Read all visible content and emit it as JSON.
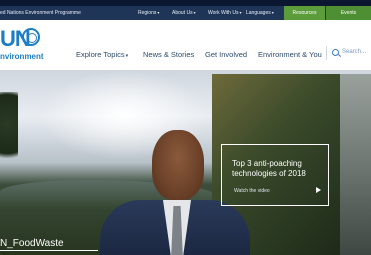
{
  "topbar": {
    "org": "ed Nations Environment Programme",
    "menu": [
      "Regions",
      "About Us",
      "Work With Us",
      "Languages"
    ],
    "resources": "Resources",
    "events": "Events"
  },
  "logo": {
    "un": "UN",
    "sub": "nvironment"
  },
  "nav": {
    "items": [
      {
        "label": "Explore Topics",
        "dropdown": true
      },
      {
        "label": "News & Stories",
        "dropdown": false
      },
      {
        "label": "Get Involved",
        "dropdown": false
      },
      {
        "label": "Environment & You",
        "dropdown": false
      }
    ],
    "search_placeholder": "Search..."
  },
  "hero": {
    "promo_title": "Top 3 anti-poaching technologies of 2018",
    "promo_cta": "Watch the video",
    "caption": "N_FoodWaste"
  },
  "colors": {
    "topbar": "#1f3557",
    "resources": "#5c9c3a",
    "events": "#4f8f33",
    "brand_blue": "#1f7ec3"
  }
}
